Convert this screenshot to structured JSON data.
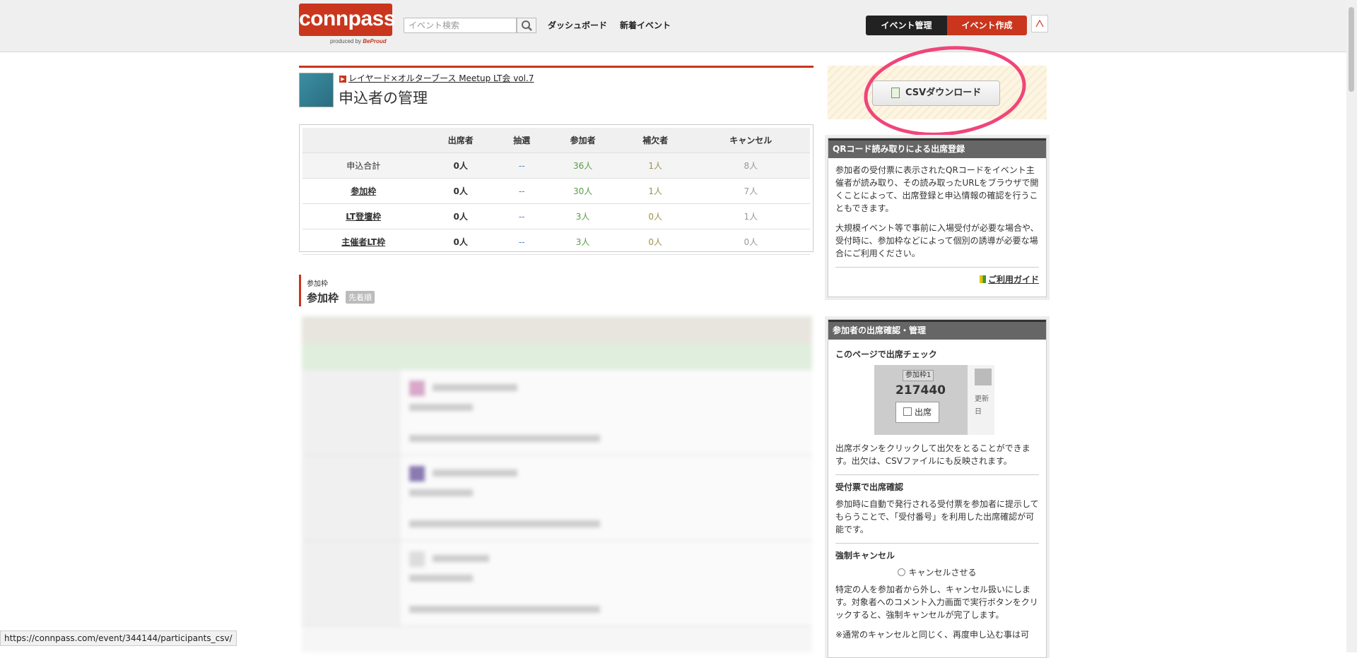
{
  "header": {
    "logo": "connpass",
    "logo_sub_prefix": "produced by",
    "logo_sub_brand": "BeProud",
    "search_placeholder": "イベント検索",
    "nav": [
      "ダッシュボード",
      "新着イベント"
    ],
    "manage_label": "イベント管理",
    "create_label": "イベント作成"
  },
  "event": {
    "link_text": "レイヤード×オルターブース Meetup LT会 vol.7",
    "page_title": "申込者の管理"
  },
  "summary": {
    "headers": [
      "",
      "出席者",
      "抽選",
      "参加者",
      "補欠者",
      "キャンセル"
    ],
    "rows": [
      [
        "申込合計",
        "0人",
        "--",
        "36人",
        "1人",
        "8人"
      ],
      [
        "参加枠",
        "0人",
        "--",
        "30人",
        "1人",
        "7人"
      ],
      [
        "LT登壇枠",
        "0人",
        "--",
        "3人",
        "0人",
        "1人"
      ],
      [
        "主催者LT枠",
        "0人",
        "--",
        "3人",
        "0人",
        "0人"
      ]
    ]
  },
  "section": {
    "small_label": "参加枠",
    "title": "参加枠",
    "tag": "先着順"
  },
  "sidebar": {
    "csv_label": "CSVダウンロード",
    "qr_panel": {
      "title": "QRコード読み取りによる出席登録",
      "p1": "参加者の受付票に表示されたQRコードをイベント主催者が読み取り、その読み取ったURLをブラウザで開くことによって、出席登録と申込情報の確認を行うこともできます。",
      "p2": "大規模イベント等で事前に入場受付が必要な場合や、受付時に、参加枠などによって個別の誘導が必要な場合にご利用ください。",
      "guide": "ご利用ガイド"
    },
    "attend_panel": {
      "title": "参加者の出席確認・管理",
      "check_heading": "このページで出席チェック",
      "demo_tag": "参加枠1",
      "demo_number": "217440",
      "demo_button": "出席",
      "demo_right_text": "更新日",
      "check_text": "出席ボタンをクリックして出欠をとることができます。出欠は、CSVファイルにも反映されます。",
      "ticket_heading": "受付票で出席確認",
      "ticket_text": "参加時に自動で発行される受付票を参加者に提示してもらうことで、「受付番号」を利用した出席確認が可能です。",
      "force_heading": "強制キャンセル",
      "force_link": "キャンセルさせる",
      "force_text": "特定の人を参加者から外し、キャンセル扱いにします。対象者へのコメント入力画面で実行ボタンをクリックすると、強制キャンセルが完了します。",
      "note_text": "※通常のキャンセルと同じく、再度申し込む事は可"
    }
  },
  "status_bar": {
    "url": "https://connpass.com/event/344144/participants_csv/"
  }
}
